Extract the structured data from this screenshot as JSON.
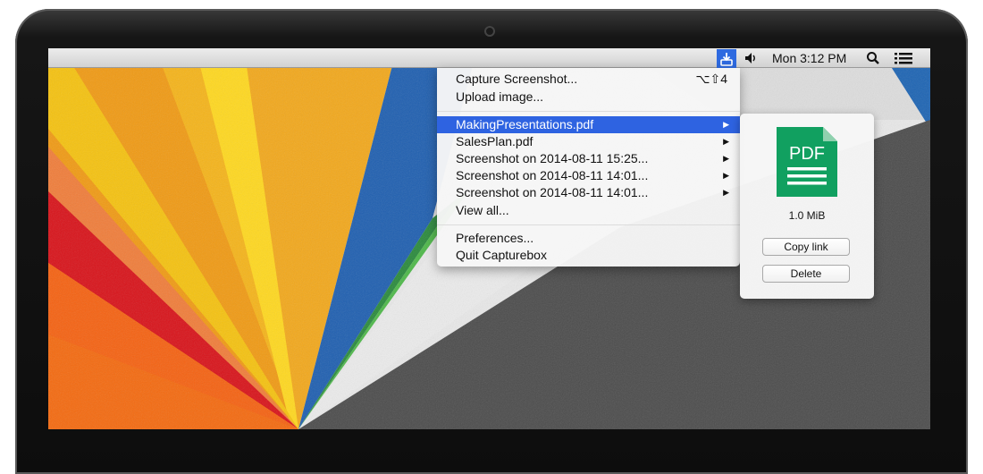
{
  "menubar": {
    "app_icon": "capturebox-icon",
    "volume_icon": "speaker-icon",
    "clock": "Mon 3:12 PM",
    "search_icon": "spotlight-search-icon",
    "list_icon": "notification-list-icon"
  },
  "menu": {
    "capture_label": "Capture Screenshot...",
    "capture_shortcut": "⌥⇧4",
    "upload_label": "Upload image...",
    "recent_items": [
      {
        "label": "MakingPresentations.pdf",
        "highlighted": true
      },
      {
        "label": "SalesPlan.pdf"
      },
      {
        "label": "Screenshot on 2014-08-11 15:25..."
      },
      {
        "label": "Screenshot on 2014-08-11 14:01..."
      },
      {
        "label": "Screenshot on 2014-08-11 14:01..."
      }
    ],
    "submenu_arrow": "▶",
    "view_all_label": "View all...",
    "preferences_label": "Preferences...",
    "quit_label": "Quit Capturebox"
  },
  "popover": {
    "file_icon_text": "PDF",
    "file_icon": "pdf-document-icon",
    "file_size": "1.0 MiB",
    "copy_link_label": "Copy link",
    "delete_label": "Delete"
  },
  "colors": {
    "highlight": "#2e63e1",
    "app_icon_bg": "#2e6ae0",
    "pdf_green": "#11a060"
  }
}
